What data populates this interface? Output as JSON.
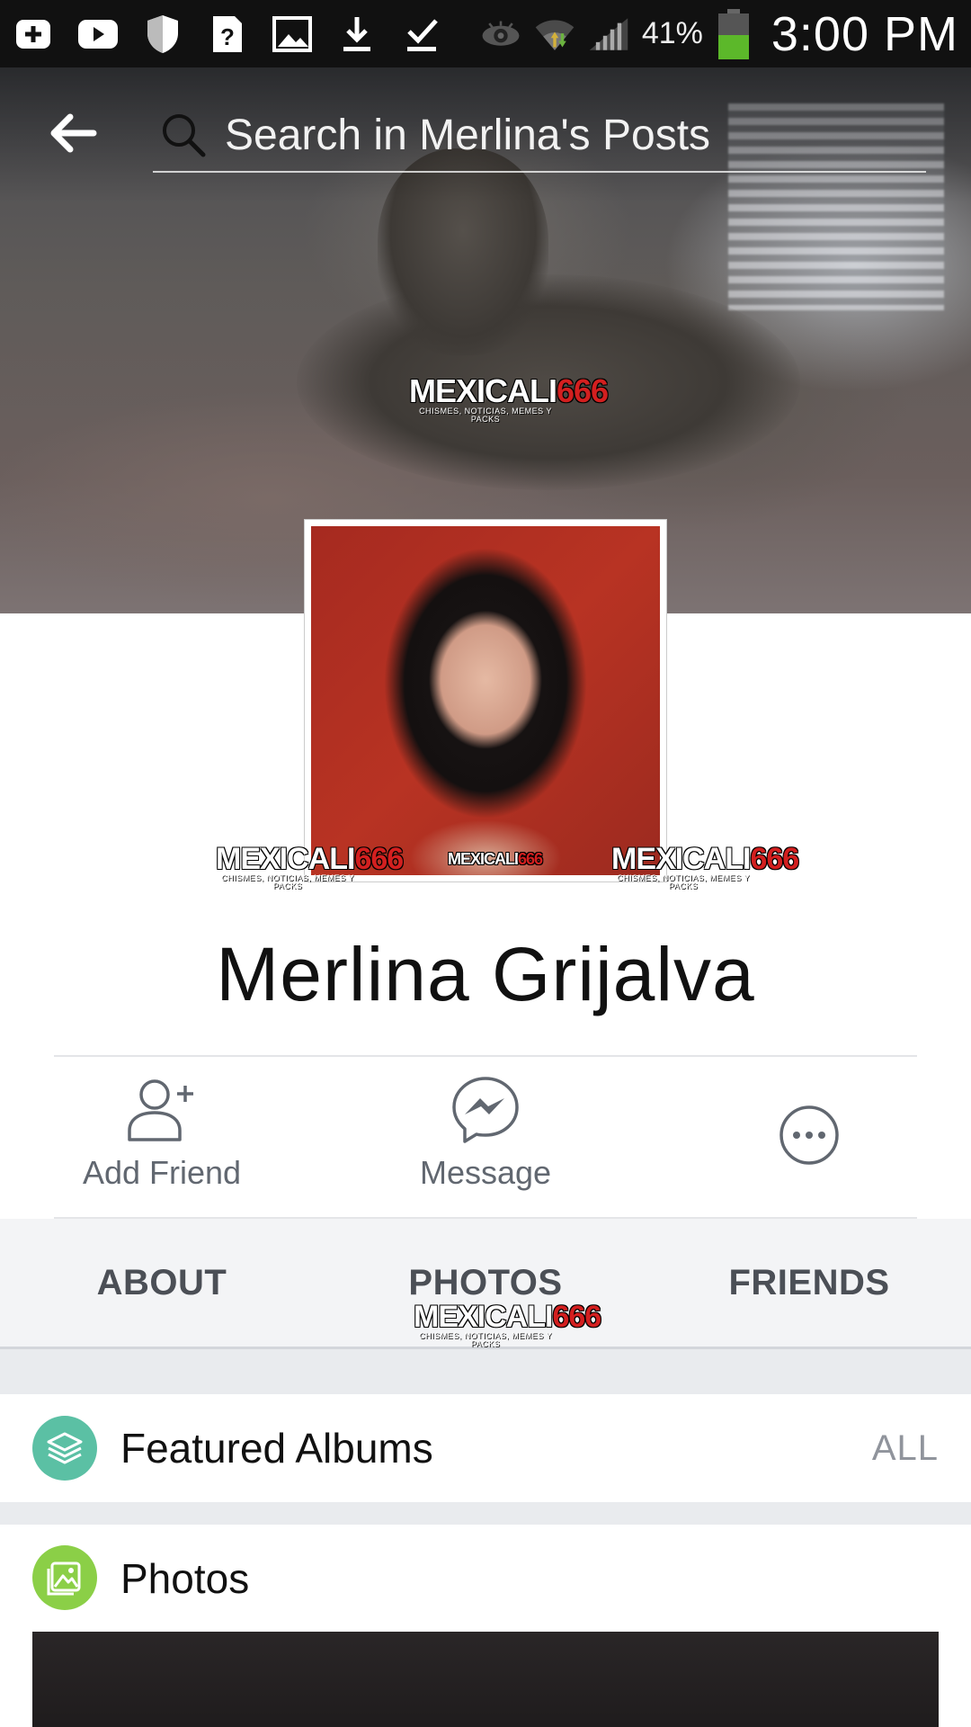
{
  "status_bar": {
    "battery_percent": "41%",
    "time": "3:00 PM",
    "icons": [
      "plus-box-icon",
      "youtube-icon",
      "shield-icon",
      "help-file-icon",
      "image-icon",
      "download-icon",
      "download-done-icon",
      "eye-icon",
      "wifi-icon",
      "signal-icon",
      "battery-icon"
    ]
  },
  "header": {
    "search_placeholder": "Search in Merlina's Posts"
  },
  "watermark": {
    "brand": "MEXICALI",
    "number": "666",
    "tagline": "CHISMES, NOTICIAS, MEMES Y PACKS"
  },
  "profile": {
    "name": "Merlina Grijalva"
  },
  "actions": {
    "add_friend": "Add Friend",
    "message": "Message"
  },
  "tabs": [
    "ABOUT",
    "PHOTOS",
    "FRIENDS"
  ],
  "featured_albums": {
    "title": "Featured Albums",
    "link": "ALL"
  },
  "photos": {
    "title": "Photos"
  },
  "colors": {
    "albums_icon_bg": "#5bc0a4",
    "photos_icon_bg": "#8bcf47",
    "tab_text": "#4b4f56",
    "secondary_text": "#616770"
  }
}
